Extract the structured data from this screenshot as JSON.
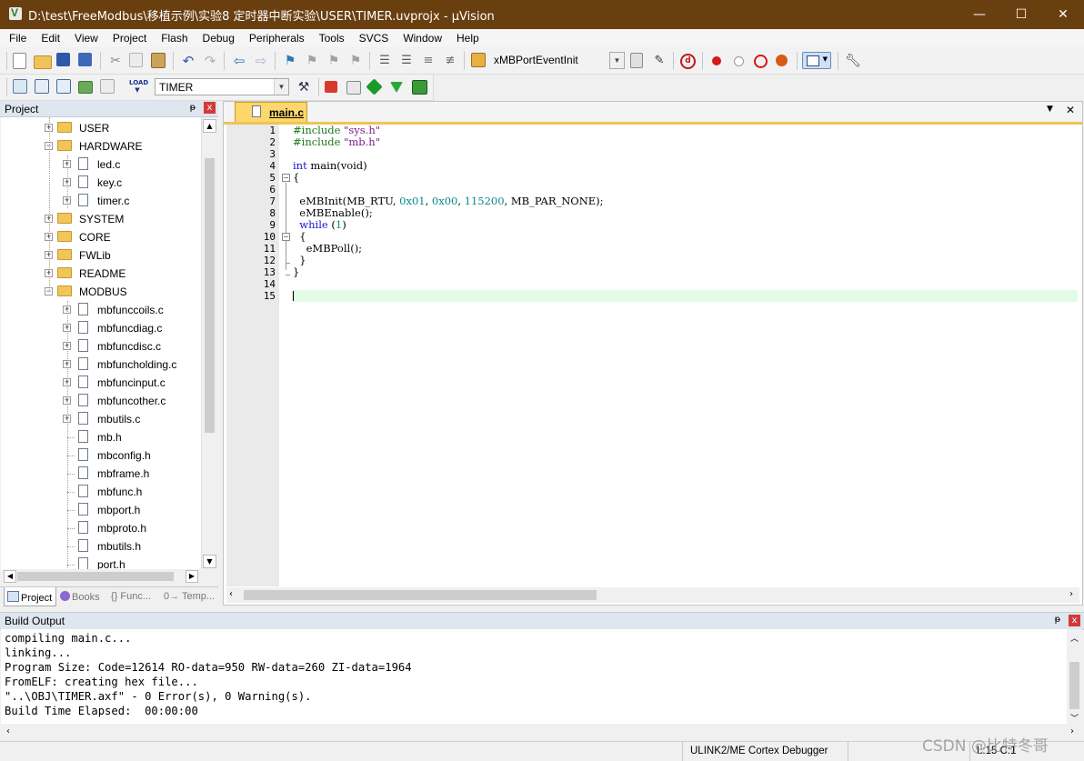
{
  "window": {
    "title": "D:\\test\\FreeModbus\\移植示例\\实验8 定时器中断实验\\USER\\TIMER.uvprojx - µVision",
    "minimize": "—",
    "maximize": "☐",
    "close": "✕"
  },
  "menu": [
    "File",
    "Edit",
    "View",
    "Project",
    "Flash",
    "Debug",
    "Peripherals",
    "Tools",
    "SVCS",
    "Window",
    "Help"
  ],
  "toolbar": {
    "function_combo": "xMBPortEventInit",
    "target_combo": "TIMER"
  },
  "project_panel": {
    "title": "Project",
    "pin": "ᵽ",
    "close": "x",
    "tree": [
      {
        "label": "USER",
        "kind": "folder",
        "expander": "+"
      },
      {
        "label": "HARDWARE",
        "kind": "folder",
        "expander": "−"
      },
      {
        "label": "led.c",
        "kind": "file",
        "expander": "+"
      },
      {
        "label": "key.c",
        "kind": "file",
        "expander": "+"
      },
      {
        "label": "timer.c",
        "kind": "file",
        "expander": "+"
      },
      {
        "label": "SYSTEM",
        "kind": "folder",
        "expander": "+"
      },
      {
        "label": "CORE",
        "kind": "folder",
        "expander": "+"
      },
      {
        "label": "FWLib",
        "kind": "folder",
        "expander": "+"
      },
      {
        "label": "README",
        "kind": "folder",
        "expander": "+"
      },
      {
        "label": "MODBUS",
        "kind": "folder",
        "expander": "−"
      },
      {
        "label": "mbfunccoils.c",
        "kind": "file",
        "expander": "+"
      },
      {
        "label": "mbfuncdiag.c",
        "kind": "file",
        "expander": "+"
      },
      {
        "label": "mbfuncdisc.c",
        "kind": "file",
        "expander": "+"
      },
      {
        "label": "mbfuncholding.c",
        "kind": "file",
        "expander": "+"
      },
      {
        "label": "mbfuncinput.c",
        "kind": "file",
        "expander": "+"
      },
      {
        "label": "mbfuncother.c",
        "kind": "file",
        "expander": "+"
      },
      {
        "label": "mbutils.c",
        "kind": "file",
        "expander": "+"
      },
      {
        "label": "mb.h",
        "kind": "file",
        "expander": ""
      },
      {
        "label": "mbconfig.h",
        "kind": "file",
        "expander": ""
      },
      {
        "label": "mbframe.h",
        "kind": "file",
        "expander": ""
      },
      {
        "label": "mbfunc.h",
        "kind": "file",
        "expander": ""
      },
      {
        "label": "mbport.h",
        "kind": "file",
        "expander": ""
      },
      {
        "label": "mbproto.h",
        "kind": "file",
        "expander": ""
      },
      {
        "label": "mbutils.h",
        "kind": "file",
        "expander": ""
      },
      {
        "label": "port.h",
        "kind": "file",
        "expander": ""
      }
    ],
    "tabs": [
      "Project",
      "Books",
      "{} Func...",
      "0→ Temp..."
    ]
  },
  "editor": {
    "tab_label": "main.c",
    "dropdown": "▼",
    "close": "✕",
    "lines": [
      "1",
      "2",
      "3",
      "4",
      "5",
      "6",
      "7",
      "8",
      "9",
      "10",
      "11",
      "12",
      "13",
      "14",
      "15"
    ],
    "code": {
      "l1_pp": "#include ",
      "l1_str": "\"sys.h\"",
      "l2_pp": "#include ",
      "l2_str": "\"mb.h\"",
      "l4_kw": "int",
      "l4_rest": " main(void)",
      "l5": "{",
      "l7_a": "  eMBInit(MB_RTU, ",
      "l7_n1": "0x01",
      "l7_b": ", ",
      "l7_n2": "0x00",
      "l7_c": ", ",
      "l7_n3": "115200",
      "l7_d": ", MB_PAR_NONE);",
      "l8": "  eMBEnable();",
      "l9_kw": "  while",
      "l9_a": " (",
      "l9_n": "1",
      "l9_b": ")",
      "l10": "  {",
      "l11": "    eMBPoll();",
      "l12": "  }",
      "l13": "}"
    }
  },
  "build_output": {
    "title": "Build Output",
    "lines": [
      "compiling main.c...",
      "linking...",
      "Program Size: Code=12614 RO-data=950 RW-data=260 ZI-data=1964",
      "FromELF: creating hex file...",
      "\"..\\OBJ\\TIMER.axf\" - 0 Error(s), 0 Warning(s).",
      "Build Time Elapsed:  00:00:00"
    ]
  },
  "status": {
    "debugger": "ULINK2/ME Cortex Debugger",
    "position": "L:15 C:1",
    "watermark": "CSDN @比特冬哥"
  }
}
